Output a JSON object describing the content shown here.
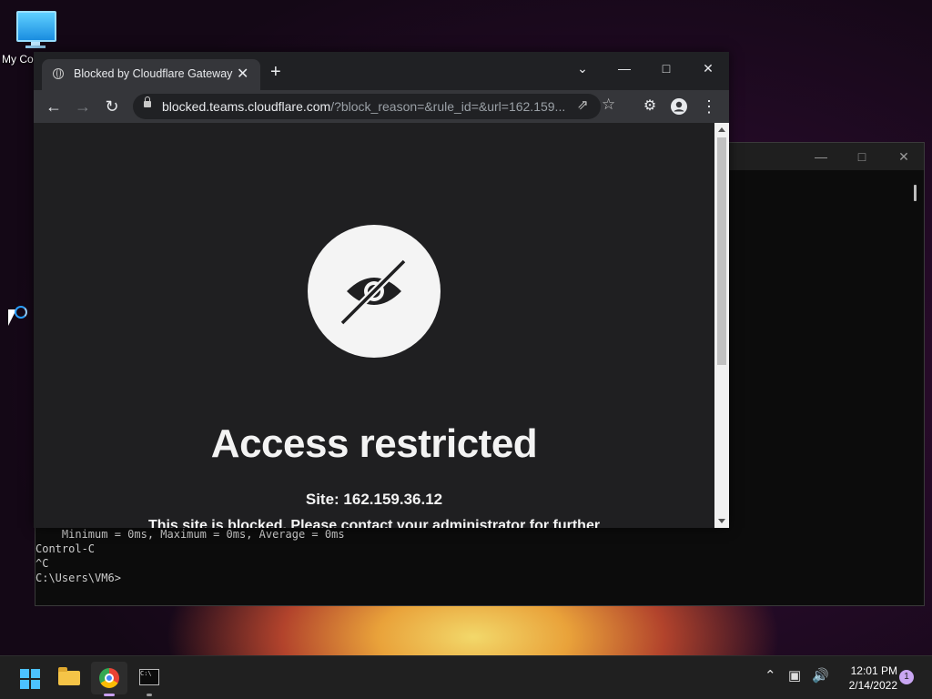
{
  "desktop": {
    "icon_label": "My Co"
  },
  "terminal": {
    "lines": [
      "    Minimum = 0ms, Maximum = 0ms, Average = 0ms",
      "Control-C",
      "^C",
      "C:\\Users\\VM6>"
    ]
  },
  "browser": {
    "tab_title": "Blocked by Cloudflare Gateway",
    "url_host": "blocked.teams.cloudflare.com",
    "url_path": "/?block_reason=&rule_id=&url=162.159...",
    "page": {
      "headline": "Access restricted",
      "site_line": "Site: 162.159.36.12",
      "message": "This site is blocked. Please contact your administrator for further"
    }
  },
  "taskbar": {
    "time": "12:01 PM",
    "date": "2/14/2022",
    "notification_count": "1",
    "apps": [
      "start",
      "file-explorer",
      "chrome",
      "command-prompt"
    ]
  },
  "colors": {
    "page_bg": "#1f1f21",
    "chrome_dark": "#202124",
    "toolbar": "#35363a",
    "windows_accent": "#4cc2ff"
  }
}
